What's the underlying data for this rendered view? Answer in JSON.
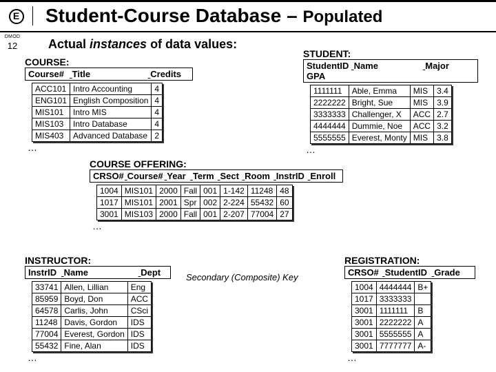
{
  "header": {
    "title_main": "Student-Course Database",
    "title_sep": " – ",
    "title_sub": "Populated",
    "left_label": "DMOD",
    "page_num": "12"
  },
  "subtitle": {
    "a": "Actual ",
    "b": "instances",
    "c": " of data values:"
  },
  "course": {
    "label": "COURSE:",
    "h1": "Course#",
    "h2": "Title",
    "h3": "Credits",
    "rows": [
      {
        "c1": "ACC101",
        "c2": "Intro Accounting",
        "c3": "4"
      },
      {
        "c1": "ENG101",
        "c2": "English Composition",
        "c3": "4"
      },
      {
        "c1": "MIS101",
        "c2": "Intro MIS",
        "c3": "4"
      },
      {
        "c1": "MIS103",
        "c2": "Intro Database",
        "c3": "4"
      },
      {
        "c1": "MIS403",
        "c2": "Advanced Database",
        "c3": "2"
      }
    ],
    "ellipsis": "…"
  },
  "student": {
    "label": "STUDENT:",
    "h1": "StudentID",
    "h2": "Name",
    "h3": "Major",
    "h4": "GPA",
    "rows": [
      {
        "c1": "1111111",
        "c2": "Able, Emma",
        "c3": "MIS",
        "c4": "3.4"
      },
      {
        "c1": "2222222",
        "c2": "Bright, Sue",
        "c3": "MIS",
        "c4": "3.9"
      },
      {
        "c1": "3333333",
        "c2": "Challenger, X",
        "c3": "ACC",
        "c4": "2.7"
      },
      {
        "c1": "4444444",
        "c2": "Dummie, Noe",
        "c3": "ACC",
        "c4": "3.2"
      },
      {
        "c1": "5555555",
        "c2": "Everest, Monty",
        "c3": "MIS",
        "c4": "3.8"
      }
    ],
    "ellipsis": "…"
  },
  "offering": {
    "label": "COURSE OFFERING:",
    "h1": "CRSO#",
    "h2": "Course#",
    "h3": "Year",
    "h4": "Term",
    "h5": "Sect",
    "h6": "Room",
    "h7": "InstrID",
    "h8": "Enroll",
    "rows": [
      {
        "c1": "1004",
        "c2": "MIS101",
        "c3": "2000",
        "c4": "Fall",
        "c5": "001",
        "c6": "1-142",
        "c7": "11248",
        "c8": "48"
      },
      {
        "c1": "1017",
        "c2": "MIS101",
        "c3": "2001",
        "c4": "Spr",
        "c5": "002",
        "c6": "2-224",
        "c7": "55432",
        "c8": "60"
      },
      {
        "c1": "3001",
        "c2": "MIS103",
        "c3": "2000",
        "c4": "Fall",
        "c5": "001",
        "c6": "2-207",
        "c7": "77004",
        "c8": "27"
      }
    ],
    "ellipsis": "…"
  },
  "instructor": {
    "label": "INSTRUCTOR:",
    "h1": "InstrID",
    "h2": "Name",
    "h3": "Dept",
    "rows": [
      {
        "c1": "33741",
        "c2": "Allen, Lillian",
        "c3": "Eng"
      },
      {
        "c1": "85959",
        "c2": "Boyd, Don",
        "c3": "ACC"
      },
      {
        "c1": "64578",
        "c2": "Carlis, John",
        "c3": "CSci"
      },
      {
        "c1": "11248",
        "c2": "Davis, Gordon",
        "c3": "IDS"
      },
      {
        "c1": "77004",
        "c2": "Everest, Gordon",
        "c3": "IDS"
      },
      {
        "c1": "55432",
        "c2": "Fine, Alan",
        "c3": "IDS"
      }
    ],
    "ellipsis": "…"
  },
  "registration": {
    "label": "REGISTRATION:",
    "h1": "CRSO#",
    "h2": "StudentID",
    "h3": "Grade",
    "rows": [
      {
        "c1": "1004",
        "c2": "4444444",
        "c3": "B+"
      },
      {
        "c1": "1017",
        "c2": "3333333",
        "c3": ""
      },
      {
        "c1": "3001",
        "c2": "1111111",
        "c3": "B"
      },
      {
        "c1": "3001",
        "c2": "2222222",
        "c3": "A"
      },
      {
        "c1": "3001",
        "c2": "5555555",
        "c3": "A"
      },
      {
        "c1": "3001",
        "c2": "7777777",
        "c3": "A-"
      }
    ],
    "ellipsis": "…"
  },
  "note_key": "Secondary (Composite) Key"
}
